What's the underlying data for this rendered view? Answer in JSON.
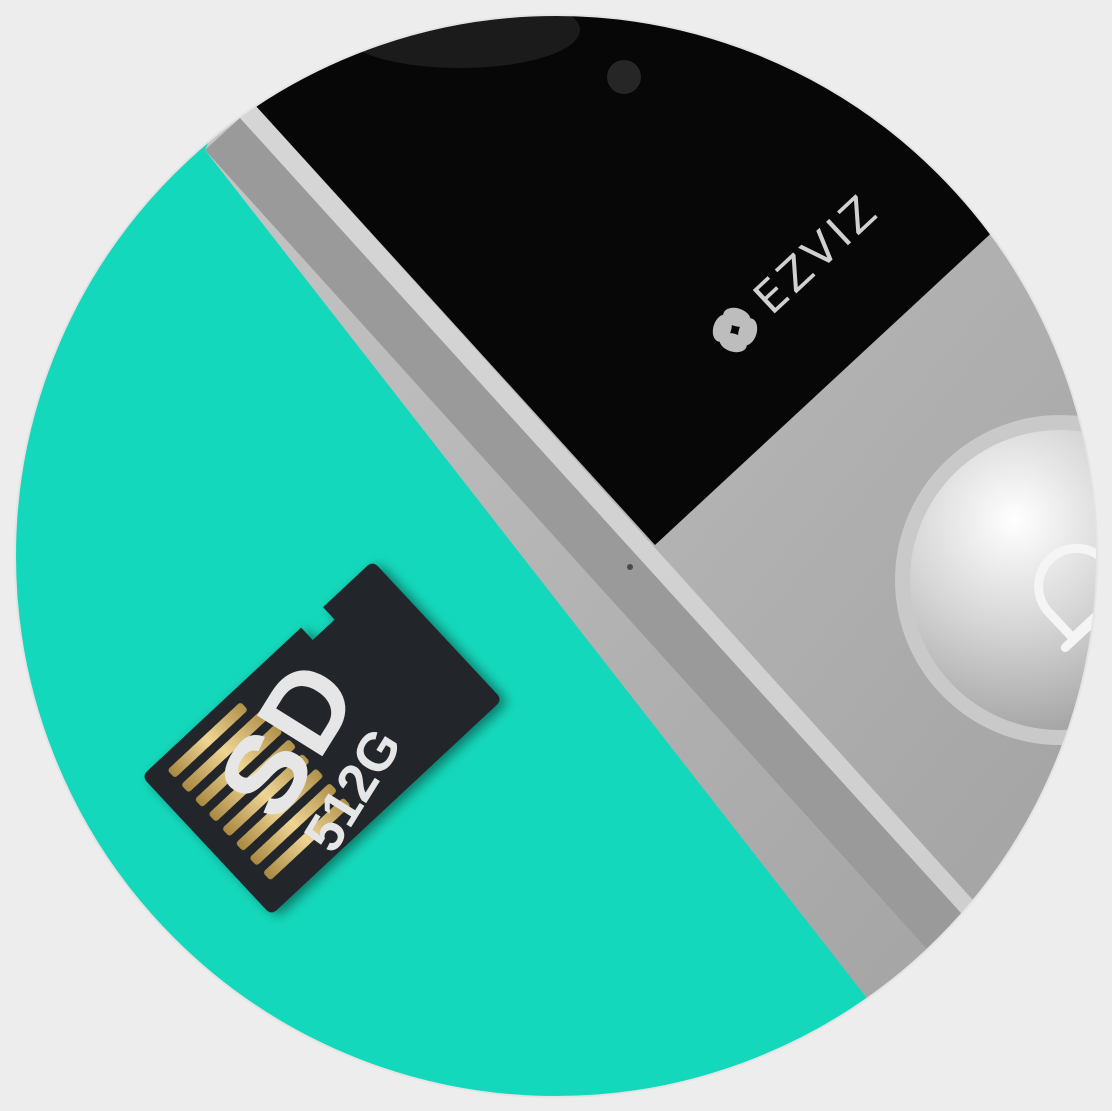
{
  "image": {
    "subject": "",
    "colors": {
      "page_background": "#ededed",
      "teal_background": "#14d8bb",
      "device_black_panel": "#070707",
      "device_silver_body": "#b4b4b4",
      "device_edge": "#8e8e8e",
      "card_body": "#22262a",
      "card_contacts": "#d4b46a",
      "button_ring": "#c9c9c9"
    }
  },
  "device": {
    "brand_text": "EZVIZ",
    "logo_icon": "ezviz-pinwheel-icon",
    "button_icon": "bell-icon"
  },
  "sd_card": {
    "label_main": "SD",
    "label_capacity": "512G",
    "contact_count": 8
  }
}
